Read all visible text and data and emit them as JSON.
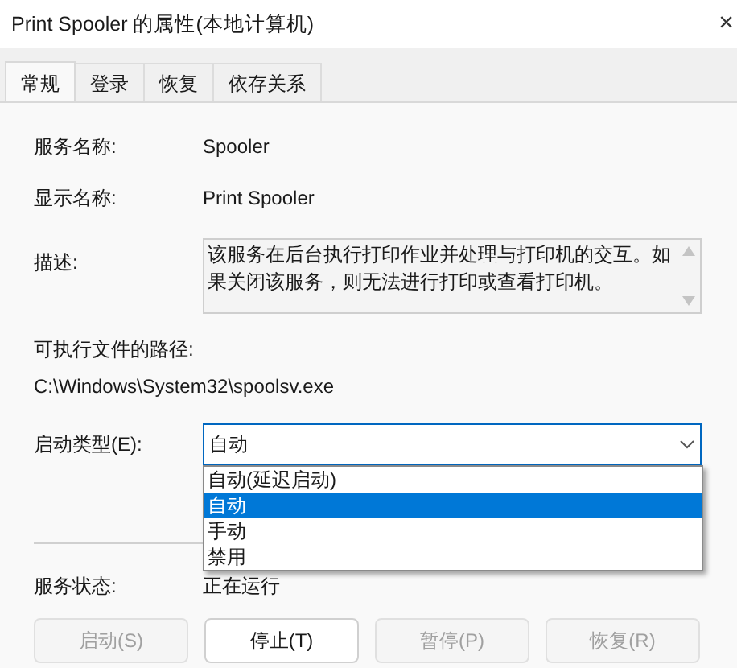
{
  "window": {
    "title": "Print Spooler 的属性(本地计算机)",
    "close": "×"
  },
  "tabs": [
    {
      "label": "常规",
      "selected": true
    },
    {
      "label": "登录",
      "selected": false
    },
    {
      "label": "恢复",
      "selected": false
    },
    {
      "label": "依存关系",
      "selected": false
    }
  ],
  "service_name": {
    "label": "服务名称:",
    "value": "Spooler"
  },
  "display_name": {
    "label": "显示名称:",
    "value": "Print Spooler"
  },
  "description": {
    "label": "描述:",
    "value": "该服务在后台执行打印作业并处理与打印机的交互。如果关闭该服务，则无法进行打印或查看打印机。"
  },
  "path": {
    "label": "可执行文件的路径:",
    "value": "C:\\Windows\\System32\\spoolsv.exe"
  },
  "startup_type": {
    "label": "启动类型(E):",
    "value": "自动",
    "expanded": true,
    "options": [
      {
        "label": "自动(延迟启动)",
        "selected": false
      },
      {
        "label": "自动",
        "selected": true
      },
      {
        "label": "手动",
        "selected": false
      },
      {
        "label": "禁用",
        "selected": false
      }
    ]
  },
  "service_status": {
    "label": "服务状态:",
    "value": "正在运行"
  },
  "buttons": [
    {
      "label": "启动(S)",
      "disabled": true
    },
    {
      "label": "停止(T)",
      "disabled": false
    },
    {
      "label": "暂停(P)",
      "disabled": true
    },
    {
      "label": "恢复(R)",
      "disabled": true
    }
  ]
}
